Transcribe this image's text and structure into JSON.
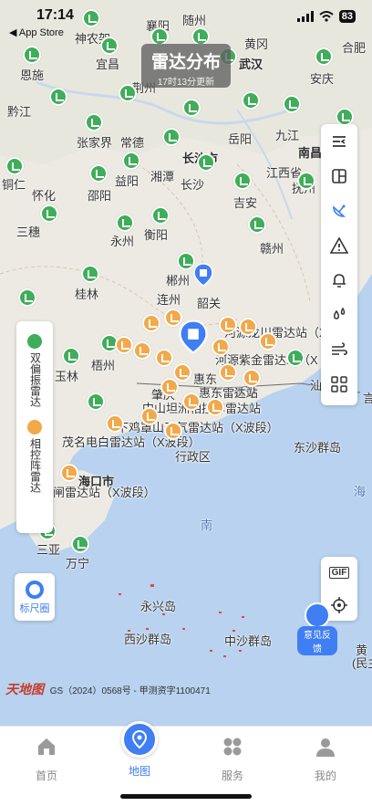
{
  "status_bar": {
    "time": "17:14",
    "back_label": "◀ App Store",
    "battery": "83"
  },
  "header": {
    "title": "雷达分布",
    "updated": "17时13分更新"
  },
  "legend": {
    "items": [
      {
        "label": "双偏振雷达",
        "color": "#3fad5a"
      },
      {
        "label": "相控阵雷达",
        "color": "#f2a94a"
      }
    ]
  },
  "cities": [
    {
      "name": "襄阳",
      "big": false
    },
    {
      "name": "随州",
      "big": false
    },
    {
      "name": "神农架",
      "big": false
    },
    {
      "name": "宜昌",
      "big": false
    },
    {
      "name": "黄冈",
      "big": false
    },
    {
      "name": "武汉",
      "big": true
    },
    {
      "name": "合肥",
      "big": false
    },
    {
      "name": "恩施",
      "big": false
    },
    {
      "name": "荆州",
      "big": false
    },
    {
      "name": "安庆",
      "big": false
    },
    {
      "name": "黔江",
      "big": false
    },
    {
      "name": "张家界",
      "big": false
    },
    {
      "name": "常德",
      "big": false
    },
    {
      "name": "长沙市",
      "big": true
    },
    {
      "name": "岳阳",
      "big": false
    },
    {
      "name": "九江",
      "big": false
    },
    {
      "name": "南昌",
      "big": true
    },
    {
      "name": "铜仁",
      "big": false
    },
    {
      "name": "怀化",
      "big": false
    },
    {
      "name": "邵阳",
      "big": false
    },
    {
      "name": "益阳",
      "big": false
    },
    {
      "name": "湘潭",
      "big": false
    },
    {
      "name": "长沙",
      "big": false
    },
    {
      "name": "吉安",
      "big": false
    },
    {
      "name": "江西省",
      "big": false
    },
    {
      "name": "抚州",
      "big": false
    },
    {
      "name": "三穗",
      "big": false
    },
    {
      "name": "永州",
      "big": false
    },
    {
      "name": "衡阳",
      "big": false
    },
    {
      "name": "赣州",
      "big": false
    },
    {
      "name": "郴州",
      "big": false
    },
    {
      "name": "桂林",
      "big": false
    },
    {
      "name": "连州",
      "big": false
    },
    {
      "name": "韶关",
      "big": false
    },
    {
      "name": "梧州",
      "big": false
    },
    {
      "name": "玉林",
      "big": false
    },
    {
      "name": "肇庆",
      "big": false
    },
    {
      "name": "惠东",
      "big": false
    },
    {
      "name": "汕头",
      "big": false
    },
    {
      "name": "香港",
      "big": false
    },
    {
      "name": "海口市",
      "big": true
    },
    {
      "name": "三亚",
      "big": false
    },
    {
      "name": "万宁",
      "big": false
    },
    {
      "name": "东沙群岛",
      "big": false
    },
    {
      "name": "永兴岛",
      "big": false
    },
    {
      "name": "西沙群岛",
      "big": false
    },
    {
      "name": "中沙群岛",
      "big": false
    }
  ],
  "radar_labels": [
    "河源龙川雷达站（X",
    "河源紫金雷达站（X",
    "中山坦洲相控阵雷达站",
    "下鸡罩山天气雷达站（X波段）",
    "茂名电白雷达站（X波段）",
    "行政区",
    "湛江",
    "闸雷达站（X波段）",
    "惠东",
    "惠东雷达站"
  ],
  "map_extra_labels": {
    "south": "南",
    "top_partial": "海",
    "side_a": "东",
    "side_b": "肆",
    "right_edge_1": "黄",
    "right_edge_2": "(民主",
    "right_edge_3": "言"
  },
  "toolbar": {
    "tools": [
      "collapse-icon",
      "layers-icon",
      "radar-dish-icon",
      "warning-icon",
      "bell-icon",
      "rain-drops-icon",
      "wind-icon",
      "grid-icon"
    ]
  },
  "ruler": {
    "label": "标尺圈"
  },
  "gif": {
    "label": "GIF"
  },
  "feedback": {
    "label": "意见反馈"
  },
  "copyright": {
    "logo": "天地图",
    "text": "GS（2024）0568号 - 甲测资字1100471"
  },
  "tabs": [
    {
      "label": "首页",
      "active": false
    },
    {
      "label": "地图",
      "active": true
    },
    {
      "label": "服务",
      "active": false
    },
    {
      "label": "我的",
      "active": false
    }
  ]
}
